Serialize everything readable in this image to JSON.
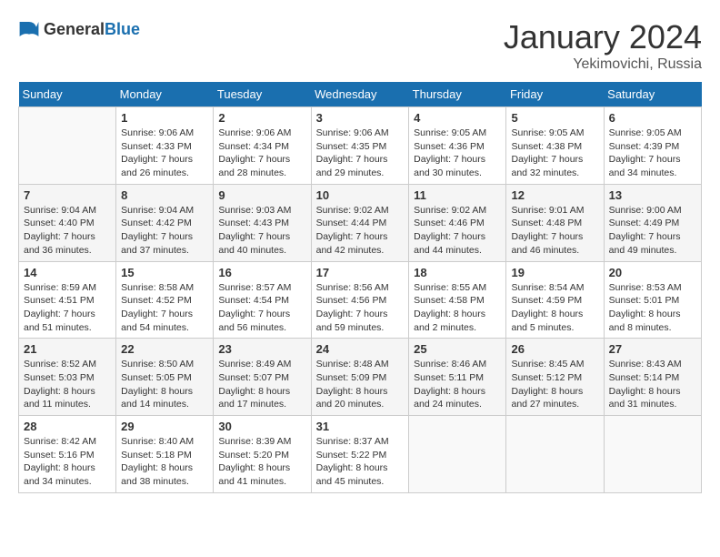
{
  "logo": {
    "general": "General",
    "blue": "Blue"
  },
  "title": "January 2024",
  "location": "Yekimovichi, Russia",
  "days_of_week": [
    "Sunday",
    "Monday",
    "Tuesday",
    "Wednesday",
    "Thursday",
    "Friday",
    "Saturday"
  ],
  "weeks": [
    [
      {
        "day": "",
        "empty": true
      },
      {
        "day": "1",
        "sunrise": "Sunrise: 9:06 AM",
        "sunset": "Sunset: 4:33 PM",
        "daylight": "Daylight: 7 hours and 26 minutes."
      },
      {
        "day": "2",
        "sunrise": "Sunrise: 9:06 AM",
        "sunset": "Sunset: 4:34 PM",
        "daylight": "Daylight: 7 hours and 28 minutes."
      },
      {
        "day": "3",
        "sunrise": "Sunrise: 9:06 AM",
        "sunset": "Sunset: 4:35 PM",
        "daylight": "Daylight: 7 hours and 29 minutes."
      },
      {
        "day": "4",
        "sunrise": "Sunrise: 9:05 AM",
        "sunset": "Sunset: 4:36 PM",
        "daylight": "Daylight: 7 hours and 30 minutes."
      },
      {
        "day": "5",
        "sunrise": "Sunrise: 9:05 AM",
        "sunset": "Sunset: 4:38 PM",
        "daylight": "Daylight: 7 hours and 32 minutes."
      },
      {
        "day": "6",
        "sunrise": "Sunrise: 9:05 AM",
        "sunset": "Sunset: 4:39 PM",
        "daylight": "Daylight: 7 hours and 34 minutes."
      }
    ],
    [
      {
        "day": "7",
        "sunrise": "Sunrise: 9:04 AM",
        "sunset": "Sunset: 4:40 PM",
        "daylight": "Daylight: 7 hours and 36 minutes."
      },
      {
        "day": "8",
        "sunrise": "Sunrise: 9:04 AM",
        "sunset": "Sunset: 4:42 PM",
        "daylight": "Daylight: 7 hours and 37 minutes."
      },
      {
        "day": "9",
        "sunrise": "Sunrise: 9:03 AM",
        "sunset": "Sunset: 4:43 PM",
        "daylight": "Daylight: 7 hours and 40 minutes."
      },
      {
        "day": "10",
        "sunrise": "Sunrise: 9:02 AM",
        "sunset": "Sunset: 4:44 PM",
        "daylight": "Daylight: 7 hours and 42 minutes."
      },
      {
        "day": "11",
        "sunrise": "Sunrise: 9:02 AM",
        "sunset": "Sunset: 4:46 PM",
        "daylight": "Daylight: 7 hours and 44 minutes."
      },
      {
        "day": "12",
        "sunrise": "Sunrise: 9:01 AM",
        "sunset": "Sunset: 4:48 PM",
        "daylight": "Daylight: 7 hours and 46 minutes."
      },
      {
        "day": "13",
        "sunrise": "Sunrise: 9:00 AM",
        "sunset": "Sunset: 4:49 PM",
        "daylight": "Daylight: 7 hours and 49 minutes."
      }
    ],
    [
      {
        "day": "14",
        "sunrise": "Sunrise: 8:59 AM",
        "sunset": "Sunset: 4:51 PM",
        "daylight": "Daylight: 7 hours and 51 minutes."
      },
      {
        "day": "15",
        "sunrise": "Sunrise: 8:58 AM",
        "sunset": "Sunset: 4:52 PM",
        "daylight": "Daylight: 7 hours and 54 minutes."
      },
      {
        "day": "16",
        "sunrise": "Sunrise: 8:57 AM",
        "sunset": "Sunset: 4:54 PM",
        "daylight": "Daylight: 7 hours and 56 minutes."
      },
      {
        "day": "17",
        "sunrise": "Sunrise: 8:56 AM",
        "sunset": "Sunset: 4:56 PM",
        "daylight": "Daylight: 7 hours and 59 minutes."
      },
      {
        "day": "18",
        "sunrise": "Sunrise: 8:55 AM",
        "sunset": "Sunset: 4:58 PM",
        "daylight": "Daylight: 8 hours and 2 minutes."
      },
      {
        "day": "19",
        "sunrise": "Sunrise: 8:54 AM",
        "sunset": "Sunset: 4:59 PM",
        "daylight": "Daylight: 8 hours and 5 minutes."
      },
      {
        "day": "20",
        "sunrise": "Sunrise: 8:53 AM",
        "sunset": "Sunset: 5:01 PM",
        "daylight": "Daylight: 8 hours and 8 minutes."
      }
    ],
    [
      {
        "day": "21",
        "sunrise": "Sunrise: 8:52 AM",
        "sunset": "Sunset: 5:03 PM",
        "daylight": "Daylight: 8 hours and 11 minutes."
      },
      {
        "day": "22",
        "sunrise": "Sunrise: 8:50 AM",
        "sunset": "Sunset: 5:05 PM",
        "daylight": "Daylight: 8 hours and 14 minutes."
      },
      {
        "day": "23",
        "sunrise": "Sunrise: 8:49 AM",
        "sunset": "Sunset: 5:07 PM",
        "daylight": "Daylight: 8 hours and 17 minutes."
      },
      {
        "day": "24",
        "sunrise": "Sunrise: 8:48 AM",
        "sunset": "Sunset: 5:09 PM",
        "daylight": "Daylight: 8 hours and 20 minutes."
      },
      {
        "day": "25",
        "sunrise": "Sunrise: 8:46 AM",
        "sunset": "Sunset: 5:11 PM",
        "daylight": "Daylight: 8 hours and 24 minutes."
      },
      {
        "day": "26",
        "sunrise": "Sunrise: 8:45 AM",
        "sunset": "Sunset: 5:12 PM",
        "daylight": "Daylight: 8 hours and 27 minutes."
      },
      {
        "day": "27",
        "sunrise": "Sunrise: 8:43 AM",
        "sunset": "Sunset: 5:14 PM",
        "daylight": "Daylight: 8 hours and 31 minutes."
      }
    ],
    [
      {
        "day": "28",
        "sunrise": "Sunrise: 8:42 AM",
        "sunset": "Sunset: 5:16 PM",
        "daylight": "Daylight: 8 hours and 34 minutes."
      },
      {
        "day": "29",
        "sunrise": "Sunrise: 8:40 AM",
        "sunset": "Sunset: 5:18 PM",
        "daylight": "Daylight: 8 hours and 38 minutes."
      },
      {
        "day": "30",
        "sunrise": "Sunrise: 8:39 AM",
        "sunset": "Sunset: 5:20 PM",
        "daylight": "Daylight: 8 hours and 41 minutes."
      },
      {
        "day": "31",
        "sunrise": "Sunrise: 8:37 AM",
        "sunset": "Sunset: 5:22 PM",
        "daylight": "Daylight: 8 hours and 45 minutes."
      },
      {
        "day": "",
        "empty": true
      },
      {
        "day": "",
        "empty": true
      },
      {
        "day": "",
        "empty": true
      }
    ]
  ]
}
